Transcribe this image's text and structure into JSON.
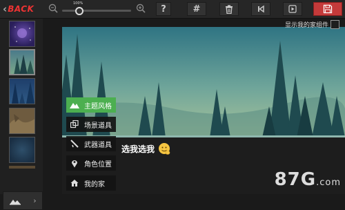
{
  "toolbar": {
    "back_label": "BACK",
    "zoom_value": "100%",
    "zoom_level": 0.25,
    "help_label": "?",
    "grid_label": "#"
  },
  "canvas": {
    "show_home_label": "显示我的家组件",
    "speech_text": "选我选我"
  },
  "menu": {
    "items": [
      {
        "label": "主题风格",
        "icon": "mountain-icon",
        "active": true
      },
      {
        "label": "场景道具",
        "icon": "layers-icon",
        "active": false
      },
      {
        "label": "武器道具",
        "icon": "weapon-icon",
        "active": false
      },
      {
        "label": "角色位置",
        "icon": "location-pin-icon",
        "active": false
      },
      {
        "label": "我的家",
        "icon": "home-icon",
        "active": false
      }
    ]
  },
  "sidebar": {
    "thumbnails": [
      "purple-night-theme",
      "forest-theme",
      "blue-forest-theme",
      "desert-theme",
      "ocean-theme"
    ]
  },
  "watermark": {
    "text": "87G",
    "suffix": ".com"
  },
  "colors": {
    "accent": "#4caf50",
    "save": "#c43a3a",
    "back": "#e33333"
  }
}
